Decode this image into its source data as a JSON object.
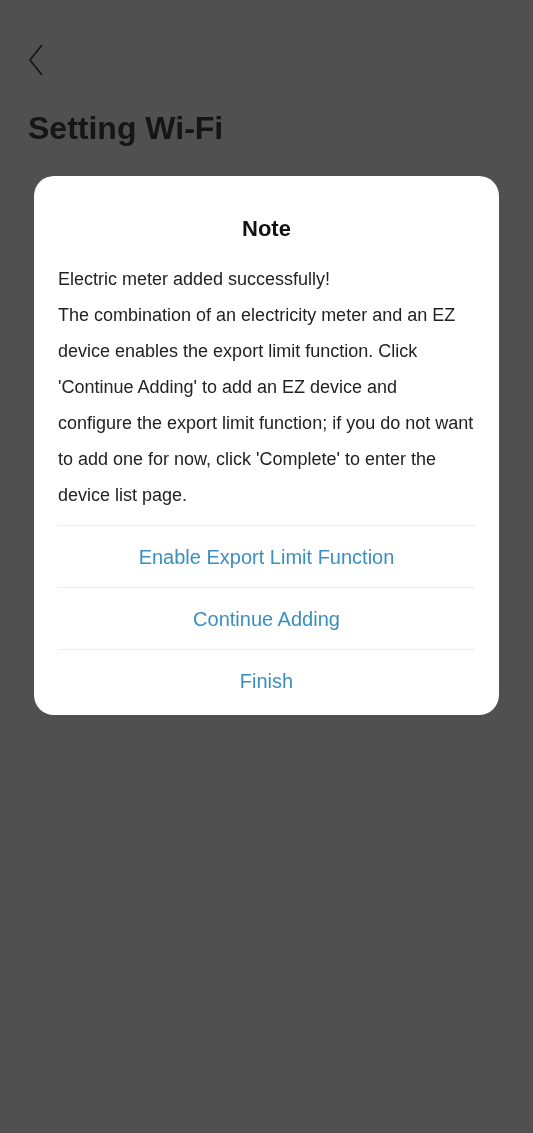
{
  "page": {
    "title": "Setting Wi-Fi"
  },
  "dialog": {
    "title": "Note",
    "message": [
      "Electric meter added successfully!",
      "The combination of an electricity meter and an EZ device enables the export limit function. Click 'Continue Adding' to add an EZ device and configure the export limit function; if you do not want to add one for now, click 'Complete' to enter the device list page."
    ],
    "actions": [
      "Enable Export Limit Function",
      "Continue Adding",
      "Finish"
    ]
  }
}
